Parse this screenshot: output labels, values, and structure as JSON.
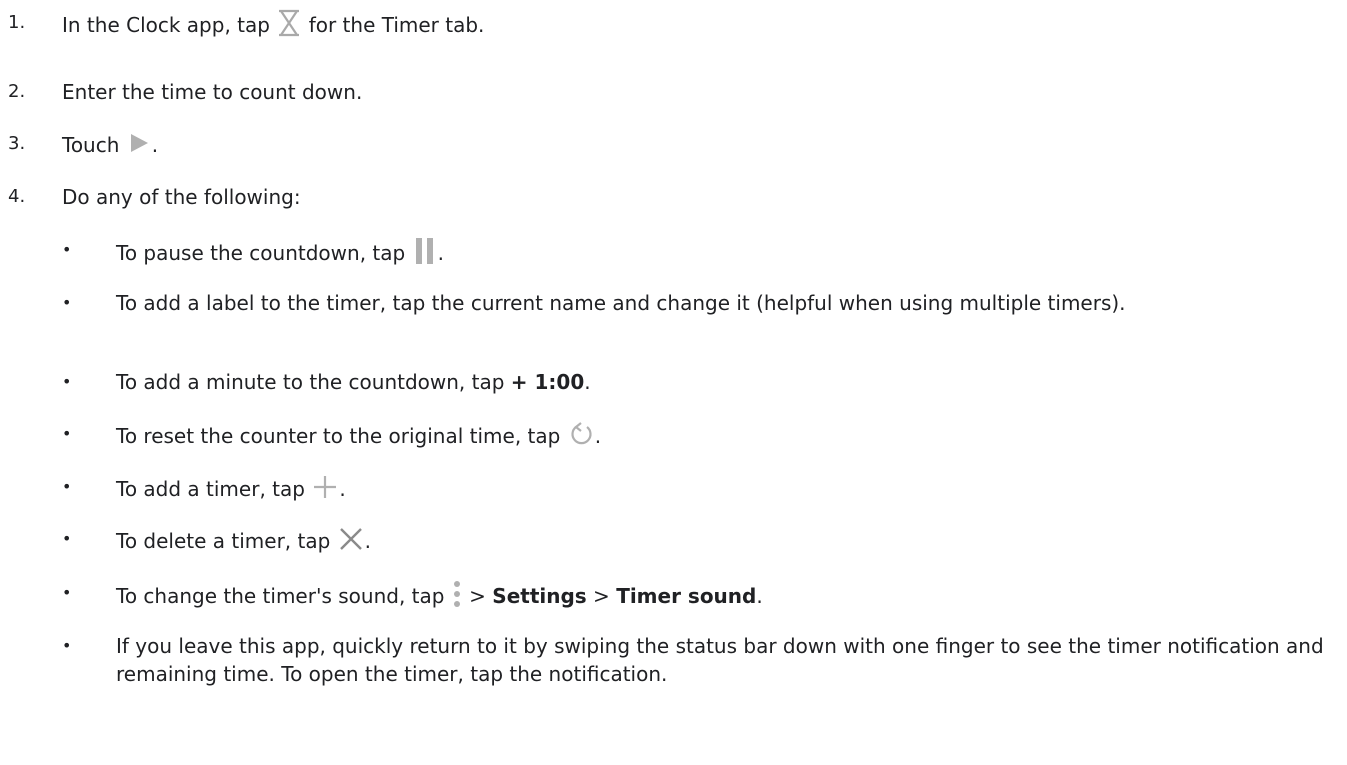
{
  "steps": [
    {
      "num": "1.",
      "before": "In the Clock app, tap",
      "after": "for the Timer tab."
    },
    {
      "num": "2.",
      "text": "Enter the time to count down."
    },
    {
      "num": "3.",
      "before": "Touch",
      "after": "."
    },
    {
      "num": "4.",
      "text": "Do any of the following:"
    }
  ],
  "bullets": [
    {
      "before": "To pause the countdown, tap",
      "after": "."
    },
    {
      "text": "To add a label to the timer, tap the current name and change it (helpful when using multiple timers)."
    },
    {
      "before": "To add a minute to the countdown, tap ",
      "bold": "+ 1:00",
      "after": "."
    },
    {
      "before": "To reset the counter to the original time, tap",
      "after": "."
    },
    {
      "before": "To add a timer, tap",
      "after": "."
    },
    {
      "before": "To delete a timer, tap",
      "after": "."
    },
    {
      "before": "To change the timer's sound, tap",
      "sep1": " > ",
      "bold1": "Settings",
      "sep2": " > ",
      "bold2": "Timer sound",
      "after": "."
    },
    {
      "text": "If you leave this app, quickly return to it by swiping the status bar down with one finger to see the timer notification and remaining time. To open the timer, tap the notification."
    }
  ],
  "bullet_char": "•",
  "icons": {
    "timer_tab": "hourglass-icon",
    "start": "play-icon",
    "pause": "pause-icon",
    "reset": "reset-icon",
    "add": "plus-icon",
    "delete": "close-icon",
    "menu": "more-vert-icon"
  },
  "colors": {
    "text": "#202124",
    "icon": "#a9a9a9"
  }
}
